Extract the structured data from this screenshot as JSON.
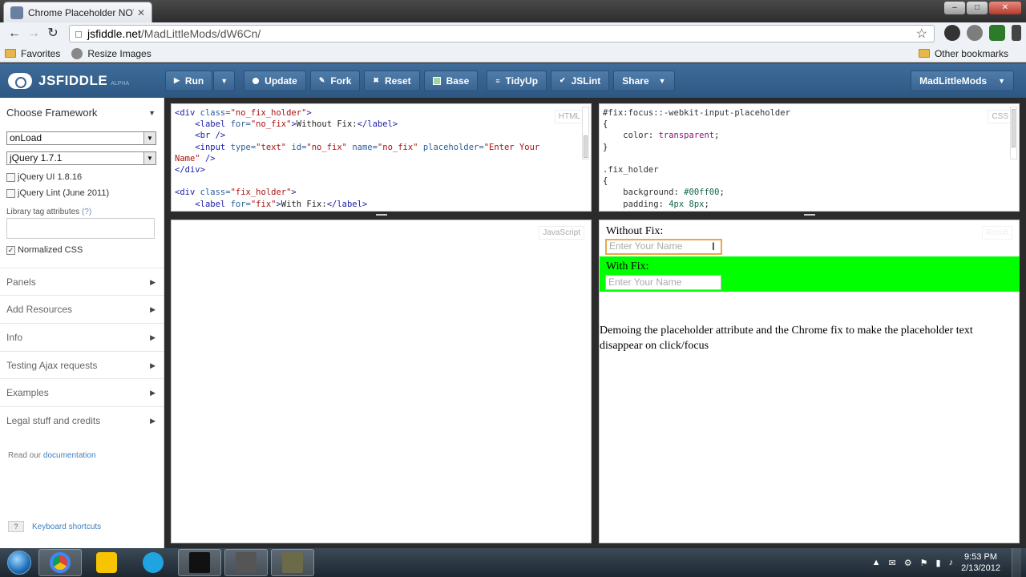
{
  "browser": {
    "tab_title": "Chrome Placeholder NOT D",
    "url_host": "jsfiddle.net",
    "url_path": "/MadLittleMods/dW6Cn/",
    "bookmarks": [
      "Favorites",
      "Resize Images"
    ],
    "other_bookmarks": "Other bookmarks"
  },
  "header": {
    "logo": "JSFIDDLE",
    "logo_sub": "ALPHA",
    "buttons": {
      "run": "Run",
      "update": "Update",
      "fork": "Fork",
      "reset": "Reset",
      "base": "Base",
      "tidyup": "TidyUp",
      "jslint": "JSLint",
      "share": "Share"
    },
    "user": "MadLittleMods"
  },
  "sidebar": {
    "choose_framework": "Choose Framework",
    "onload_select": "onLoad",
    "framework_select": "jQuery 1.7.1",
    "opt_jquery_ui": "jQuery UI 1.8.16",
    "opt_jquery_lint": "jQuery Lint (June 2011)",
    "lib_tag_attrs": "Library tag attributes",
    "lib_tag_help": "(?)",
    "normalized_css": "Normalized CSS",
    "sections": [
      "Panels",
      "Add Resources",
      "Info",
      "Testing Ajax requests",
      "Examples",
      "Legal stuff and credits"
    ],
    "read_our": "Read our",
    "documentation": "documentation",
    "keyboard_shortcuts": "Keyboard shortcuts",
    "kbd_key": "?"
  },
  "panels": {
    "html_label": "HTML",
    "css_label": "CSS",
    "js_label": "JavaScript",
    "result_label": "Result"
  },
  "result": {
    "without_fix_label": "Without Fix:",
    "with_fix_label": "With Fix:",
    "placeholder": "Enter Your Name",
    "demo_text": "Demoing the placeholder attribute and the Chrome fix to make the placeholder text disappear on click/focus",
    "fix_color": "#00ff00"
  },
  "taskbar": {
    "time": "9:53 PM",
    "date": "2/13/2012"
  }
}
